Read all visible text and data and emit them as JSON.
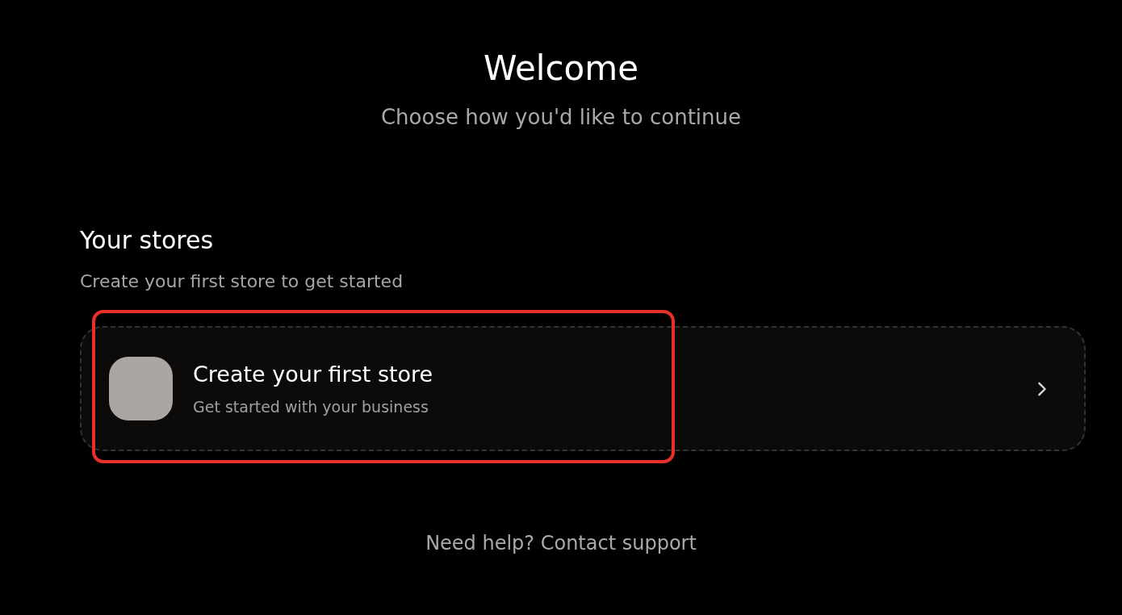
{
  "header": {
    "title": "Welcome",
    "subtitle": "Choose how you'd like to continue"
  },
  "stores": {
    "heading": "Your stores",
    "description": "Create your first store to get started",
    "card": {
      "title": "Create your first store",
      "subtitle": "Get started with your business",
      "highlighted": true
    }
  },
  "footer": {
    "help_link": "Need help? Contact support"
  }
}
